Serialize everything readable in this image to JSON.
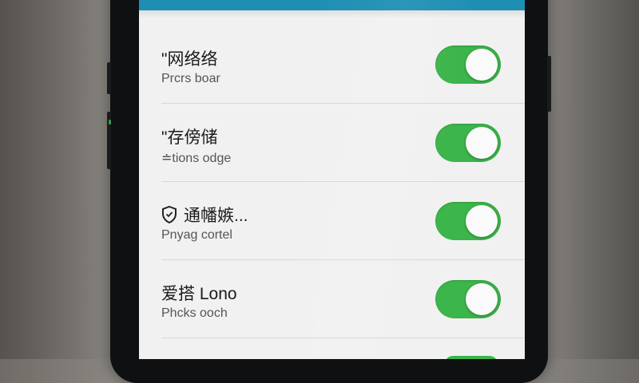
{
  "colors": {
    "app_bar": "#1e8fb3",
    "toggle_on": "#3cb54a",
    "screen_bg": "#f1f1f1"
  },
  "settings": [
    {
      "title": "\"网络络",
      "subtitle": "Prcrs boar",
      "enabled": true,
      "icon": ""
    },
    {
      "title": "\"存傍储",
      "subtitle": "≐tions odge",
      "enabled": true,
      "icon": ""
    },
    {
      "title": "通幡嫉...",
      "subtitle": "Pnyag cortel",
      "enabled": true,
      "icon": "shield-icon"
    },
    {
      "title": "爱搭 Lono",
      "subtitle": "Phcks ooch",
      "enabled": true,
      "icon": ""
    }
  ]
}
